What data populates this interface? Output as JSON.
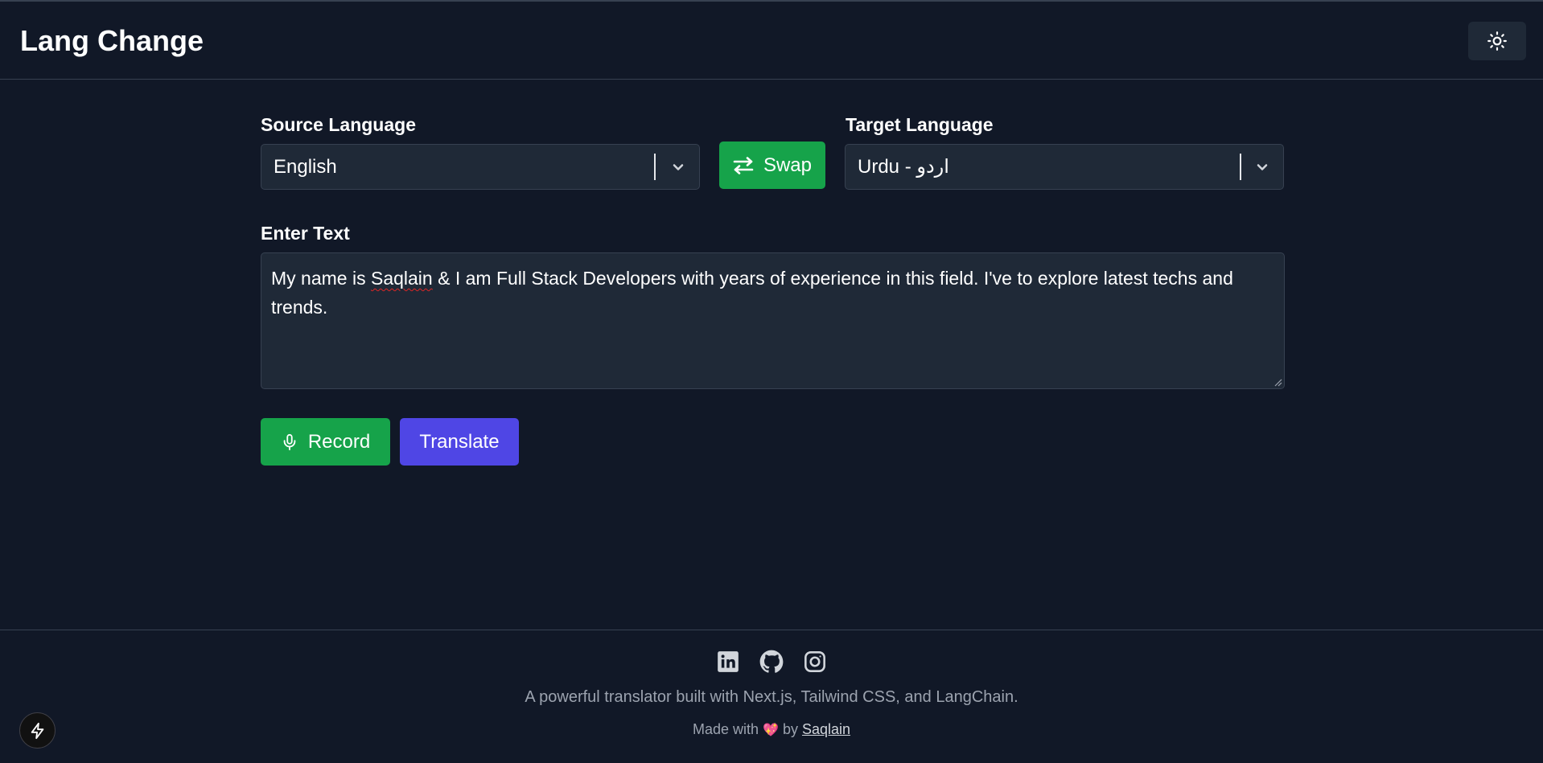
{
  "header": {
    "title": "Lang Change",
    "theme_toggle_icon": "sun-icon"
  },
  "form": {
    "source_label": "Source Language",
    "source_value": "English",
    "swap_label": "Swap",
    "target_label": "Target Language",
    "target_value": "Urdu - اردو",
    "text_label": "Enter Text",
    "text_value": {
      "part1": "My name is ",
      "misspelled": "Saqlain",
      "part2": " & I am Full Stack Developers with years of experience in this field. I've to explore latest techs and trends."
    },
    "record_label": "Record",
    "translate_label": "Translate"
  },
  "footer": {
    "social_icons": [
      "linkedin-icon",
      "github-icon",
      "instagram-icon"
    ],
    "tagline": "A powerful translator built with Next.js, Tailwind CSS, and LangChain.",
    "made_with": "Made with",
    "heart": "💖",
    "by": "by",
    "author": "Saqlain"
  },
  "colors": {
    "background": "#111827",
    "surface": "#1f2937",
    "green": "#16a34a",
    "indigo": "#4f46e5"
  }
}
